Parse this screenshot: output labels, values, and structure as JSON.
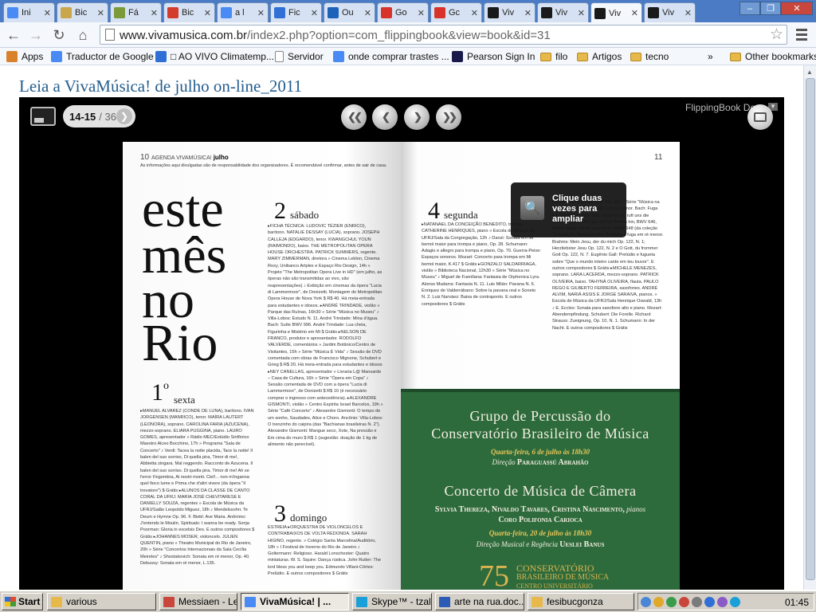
{
  "browser": {
    "tabs": [
      {
        "label": "Ini",
        "icon": "google-icon",
        "color": "#4a8af4"
      },
      {
        "label": "Bic",
        "icon": "cube-icon",
        "color": "#c9a64a"
      },
      {
        "label": "Fá",
        "icon": "puzzle-icon",
        "color": "#7b9a3a"
      },
      {
        "label": "Bic",
        "icon": "bookmark-icon",
        "color": "#d33b2c"
      },
      {
        "label": "a l",
        "icon": "google-icon",
        "color": "#4a8af4"
      },
      {
        "label": "Fic",
        "icon": "globe-icon",
        "color": "#2f6fd6"
      },
      {
        "label": "Ou",
        "icon": "outlook-icon",
        "color": "#1c62b9"
      },
      {
        "label": "Go",
        "icon": "star-icon",
        "color": "#d8332a"
      },
      {
        "label": "Gc",
        "icon": "star-icon",
        "color": "#d8332a"
      },
      {
        "label": "Viv",
        "icon": "vivamusica-icon",
        "color": "#1a1a1a"
      },
      {
        "label": "Viv",
        "icon": "vivamusica-icon",
        "color": "#1a1a1a"
      },
      {
        "label": "Viv",
        "icon": "vivamusica-icon",
        "color": "#1a1a1a"
      },
      {
        "label": "Viv",
        "icon": "vivamusica-icon",
        "color": "#1a1a1a"
      }
    ],
    "active_tab": 11,
    "url_host": "www.vivamusica.com.br",
    "url_path": "/index2.php?option=com_flippingbook&view=book&id=31",
    "bookmarks": [
      {
        "label": "Apps",
        "icon": "apps-icon"
      },
      {
        "label": "Traductor de Google",
        "icon": "translate-icon"
      },
      {
        "label": "□ AO VIVO Climatemp...",
        "icon": "weather-icon"
      },
      {
        "label": "Servidor",
        "icon": "page-icon"
      },
      {
        "label": "onde comprar trastes ...",
        "icon": "google-icon"
      },
      {
        "label": "Pearson Sign In",
        "icon": "pearson-icon"
      },
      {
        "label": "filo",
        "icon": "folder-icon"
      },
      {
        "label": "Artigos",
        "icon": "folder-icon"
      },
      {
        "label": "tecno",
        "icon": "folder-icon"
      },
      {
        "label": "»",
        "icon": "chevron-icon"
      },
      {
        "label": "Other bookmarks",
        "icon": "folder-icon"
      }
    ]
  },
  "page": {
    "heading": "Leia a VivaMúsica! de julho on-line_2011"
  },
  "flipbook": {
    "page_range": "14-15",
    "page_total": "/ 36",
    "brand": "FlippingBook Dem",
    "zoom_hint": "Clique duas vezes para ampliar",
    "left_page": {
      "number": "10",
      "header_prefix": "AGENDA VIVAMÚSICA!",
      "header_month": "julho",
      "disclaimer": "As informações aqui divulgadas são de responsabilidade dos organizadores. É recomendável confirmar, antes de sair de casa.",
      "title_lines": [
        "este",
        "mês",
        "no",
        "Rio"
      ],
      "day1_num": "1",
      "day1_sup": "o",
      "day1_name": "sexta",
      "day1_text": "▸MANUEL ALVAREZ (CONDE DE LUNA), barítono. IVAN JORGENSEN (MANRICO), tenor. MAÍRA LAUTERT (LEONORA), soprano. CAROLINA FARIA (AZUCENA), mezzo-soprano. ELIARA PUGGINA, piano. LAURO GOMES, apresentador » Rádio MEC/Estúdio Sinfônico Maestro Alceo Bocchino, 17h » Programa \"Sala de Concerto\" ♪ Verdi: Tacea la notte placida, Tace la notte! Il balen del suo sorriso, Di quella pira, Timor di me!, Abbietta zingara. Mal reggendo. Racconto de Azucena. Il balen del suo sorriso. Di quella pira. Timor di me! Ah se l'error t'ingombra, Ai nostri monti. Ciel!... non m'inganna quel fioco lume e Prima che d'altri vivere (da ópera \"Il trovatore\") $ Grátis  ▸ALUNOS DA CLASSE DE CANTO CORAL DA UFRJ. MARIA JOSÉ CHEVITARESE E DANIELLY SOUZA, regentes » Escola de Música da UFRJ/Salão Leopoldo Miguez, 18h ♪ Mendelssohn: Te Deum e Hymne Op. 96. F. Biebl: Ave Maria. Anônimo: J'entends le Moulin. Spirituals: I wanna be ready. Sonja Poorman: Gloria in excelsis Deo. E outros compositores $ Grátis  ▸JOHANNES MOSER, violoncelo. JULIEN QUENTIN, piano » Theatro Municipal do Rio de Janeiro, 20h » Série \"Concertos Internacionais da Sala Cecília Meireles\" ♪ Shostakovich: Sonata em ré menor, Op. 40. Debussy: Sonata em ré menor, L.135.",
      "day2_num": "2",
      "day2_name": "sábado",
      "day2_text": "▸FICHA TÉCNICA: LUDOVIC TÉZIER (ENRICO), barítono. NATALIE DESSAY (LUCIA), soprano. JOSEPH CALLEJA (EDGARDO), tenor. KWANGCHUL YOUN (RAIMONDO), baixo. THE METROPOLITAN OPERA HOUSE ORCHESTRA. PATRICK SUMMERS, regente. MARY ZIMMERMAN, diretora » Cinema Leblon, Cinema Roxy, Unibanco Artplex e Espaço Rio Design, 14h » Projeto \"The Metropolitan Opera Live in HD\" (em julho, as óperas não são transmitidas ao vivo, são reapresentações) ♪ Exibição em cinemas da ópera \"Lucia di Lammermoor\", de Donizetti. Montagem do Metropolitan Opera House de Nova York $ R$ 40. Há meia-entrada para estudantes e idosos.  ▸ANDRÉ TRINDADE, violão » Parque das Ruínas, 16h30 » Série \"Música no Museu\" ♪ Villa-Lobos: Estudo N. 11. André Trindade: Mina d'água. Bach: Suíte BWV 996. André Trindade: Lua cheia, Figurinha e Mistério em Mi $ Grátis  ▸NELSON DE FRANCO, produtor e apresentador. RODOLFO VALVERDE, comentários » Jardim Botânico/Centro de Visitantes, 15h » Série \"Música É Vida\" ♪ Sessão de DVD comentada com obras de Francisco Mignone, Schubert e Grieg $ R$ 20. Há meia-entrada para estudantes e idosos  ▸NEY CANELLAS, apresentador » Livraria L@ Mansarde – Casa de Cultura, 16h » Série \"Ópera em Copa\" ♪ Sessão comentada de DVD com a ópera \"Lucia di Lammermoor\", de Donizetti $ R$ 10 (é necessário comprar o ingresso com antecedência).  ▸ALEXANDRE GISMONTI, violão » Centro Espírita Israel Barcelos, 19h » Série \"Café Concerto\" ♪ Alexandre Gismonti: O tempo de um sonho, Saudades, Alice e Choro. Ancônio: Villa-Lobos: O trenzinho do caipira (das \"Bachianas brasileiras N. 2\"). Alexandre Gismonti: Mangue seco, Xote, Na pressão e Em cima do muro $ R$ 1 (sugestão: doação de 1 kg de alimento não perecível).",
      "day3_num": "3",
      "day3_name": "domingo",
      "day3_text": "ESTREIA ▸ORQUESTRA DE VIOLONCELOS E CONTRABAIXOS DE VOLTA REDONDA. SARAH HIGINO, regente. » Colégio Santa Marcelina/Auditório, 18h » I Festival de Inverno do Rio de Janeiro ♪ Goltermann: Religioso. Harald Lonschester: Quatro miniaturas. W. S. Squire: Dança rústica. John Rutter: The lord bless you and keep you. Edmundo Villani-Côrtes: Prelúdio. E outros compositores $ Grátis"
    },
    "right_page": {
      "number": "11",
      "day4_num": "4",
      "day4_name": "segunda",
      "day4_text": "▸NATANAEL DA CONCEIÇÃO BENEDITO, trompa. CATHERINE HENRIQUES, piano » Escola de Música da UFRJ/Sala da Congregação, 12h ♪ Danzi: Sonata em Mi bemol maior para trompa e piano, Op. 28. Schumann: Adagio e allegro para trompa e piano, Op. 70. Guerra-Peixe: Espaços sonoros. Mozart: Concerto para trompa em Mi bemol maior, K.417 $ Grátis  ▸GONZALO SALDARRIAGA, violão » Biblioteca Nacional, 12h30 » Série \"Música no Museu\" ♪ Miguel de Fuenllana: Fantasia de Orphenica Lyra. Alonso Mudarra: Fantasia N. 11. Luis Milán: Pavana N. 6. Enriquez de Valderrábano: Sobre la pavana real e Soneto N. 2. Luiz Narváez: Baixa de contraponto. E outros compositores $ Grátis",
      "col2_text": "Catedral Metropolitana do Rio, 11h » Série \"Música na Catedral\" ♪ Bach: Prelúdio em sol menor. Bach: Fuga em Sol maior, BWV 550. Wachet auf, ruft uns die Stimme, BWV 645. Wo soll ich fliehen hin, BWV 646, Meine Seele erhebt den Herrn, BWV 648 (da coleção \"Schübler\"). Mendelssohn: Prelúdio e fuga em ré menor. Brahms: Mein Jesu, der du mich Op. 122, N. 1; Herzliebster Jesu Op. 122, N. 2 e O Gott, du frommer Gott Op. 122, N. 7. Eugênio Gall: Prelúdio e fugueta sobre \"Que o mundo inteiro cante em teu louvor\". E outros compositores $ Grátis  ▸MICHELE MENEZES, soprano. LARA LACERDA, mezzo-soprano. PATRICK OLIVEIRA, baixo. TAHYNÁ OLIVEIRA, flauta. PAULO REGO E GILBERTO FERREIRA, saxofones. ANDRÉ ALVIM, NARIÁ ASSIS E JORGE SARAIVA, pianos. » Escola de Música da UFRJ/Sala Henrique Oswald, 13h ♪ E. Eccles: Sonata para saxofone alto e piano. Mozart: Abendempfindung. Schubert: Die Forelle. Richard Strauss: Zueignung, Op. 10, N. 1. Schumann: In der Nacht. E outros compositores $ Grátis",
      "ad": {
        "title1": "Grupo de Percussão do",
        "title2": "Conservatório Brasileiro de Música",
        "date1": "Quarta-feira, 6 de julho às 18h30",
        "dir1_prefix": "Direção",
        "dir1_name": "Paraguassú Abrahão",
        "title3": "Concerto de Música de Câmera",
        "pianists": "Sylvia Thereza, Nivaldo Tavares, Cristina Nascimento,",
        "pianists_suffix": "pianos",
        "choir": "Coro Polifonia Carioca",
        "date2": "Quarta-feira, 20 de julho às 18h30",
        "dir2_prefix": "Direção Musical e Regência",
        "dir2_name": "Ueslei Banus",
        "logo_number": "75",
        "logo_line1": "CONSERVATÓRIO",
        "logo_line2": "BRASILEIRO DE MÚSICA",
        "logo_line3": "CENTRO UNIVERSITÁRIO"
      }
    }
  },
  "taskbar": {
    "start_label": "Start",
    "items": [
      {
        "label": "various",
        "icon": "folder-icon"
      },
      {
        "label": "Messiaen - Les ...",
        "icon": "document-icon"
      },
      {
        "label": "VivaMúsica! | ...",
        "icon": "chrome-icon"
      },
      {
        "label": "Skype™ - tzalogon",
        "icon": "skype-icon"
      },
      {
        "label": "arte na rua.doc...",
        "icon": "word-icon"
      },
      {
        "label": "fesibucgonza",
        "icon": "folder-icon"
      }
    ],
    "active_item": 2,
    "clock": "01:45"
  },
  "colors": {
    "heading_blue": "#245d8e",
    "ad_green": "#2e6b3c",
    "ad_gold": "#e8c65a",
    "taskbar_gray": "#d4d0c8"
  }
}
